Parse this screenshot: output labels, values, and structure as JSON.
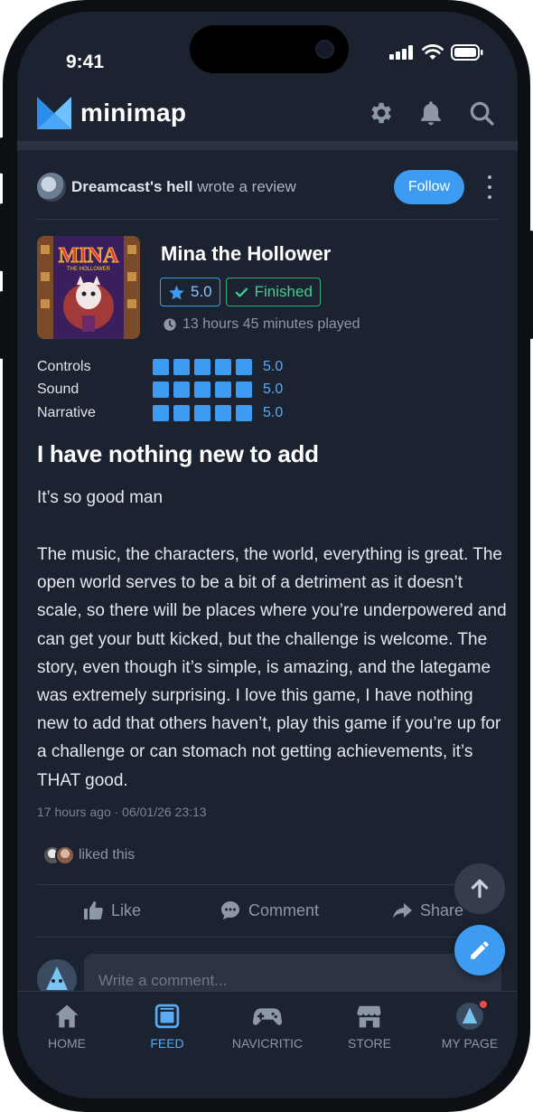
{
  "status_bar": {
    "time": "9:41"
  },
  "app": {
    "name": "minimap"
  },
  "header_icons": [
    "gear-icon",
    "bell-icon",
    "search-icon"
  ],
  "review": {
    "author": "Dreamcast's hell",
    "action_text": "wrote a review",
    "follow_label": "Follow",
    "game_title": "Mina the Hollower",
    "cover_title": "MINA",
    "cover_subtitle": "THE HOLLOWER",
    "score": "5.0",
    "status": "Finished",
    "played": "13 hours 45 minutes played",
    "ratings": [
      {
        "label": "Controls",
        "value": "5.0",
        "filled": 5
      },
      {
        "label": "Sound",
        "value": "5.0",
        "filled": 5
      },
      {
        "label": "Narrative",
        "value": "5.0",
        "filled": 5
      }
    ],
    "title": "I have nothing new to add",
    "subtitle": "It’s so good man",
    "body": "The music, the characters, the world, everything is great. The open world serves to be a bit of a detriment as it doesn’t scale, so there will be places where you’re underpowered and can get your butt kicked, but the challenge is welcome. The story, even though it’s simple, is amazing, and the lategame was extremely surprising. I love this game, I have nothing new to add that others haven’t, play this game if you’re up for a challenge or can stomach not getting achievements, it’s THAT good.",
    "timestamp": "17 hours ago · 06/01/26 23:13",
    "liked_text": "liked this"
  },
  "actions": {
    "like": "Like",
    "comment": "Comment",
    "share": "Share"
  },
  "comment": {
    "placeholder": "Write a comment..."
  },
  "tabs": [
    {
      "label": "HOME",
      "icon": "home-icon",
      "active": false
    },
    {
      "label": "FEED",
      "icon": "feed-icon",
      "active": true
    },
    {
      "label": "NAVICRITIC",
      "icon": "gamepad-icon",
      "active": false
    },
    {
      "label": "STORE",
      "icon": "store-icon",
      "active": false
    },
    {
      "label": "MY PAGE",
      "icon": "avatar-icon",
      "active": false
    }
  ],
  "colors": {
    "accent": "#3d9bf2",
    "finished": "#3fcf8f",
    "background": "#1b2230",
    "notification": "#f04848"
  }
}
